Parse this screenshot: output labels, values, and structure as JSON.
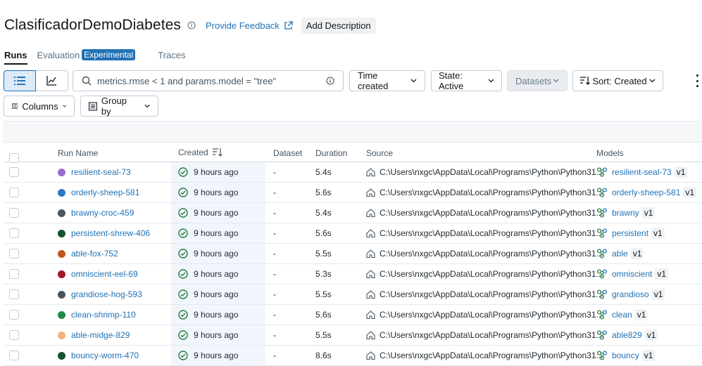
{
  "header": {
    "title": "ClasificadorDemoDiabetes",
    "feedback_label": "Provide Feedback",
    "add_description_label": "Add Description"
  },
  "tabs": {
    "runs": "Runs",
    "evaluation": "Evaluation",
    "experimental_badge": "Experimental",
    "traces": "Traces"
  },
  "toolbar": {
    "search_value": "metrics.rmse < 1 and params.model = \"tree\"",
    "time_created": "Time created",
    "state": "State: Active",
    "datasets": "Datasets",
    "sort": "Sort: Created",
    "columns": "Columns",
    "group_by": "Group by"
  },
  "table": {
    "headers": {
      "run_name": "Run Name",
      "created": "Created",
      "dataset": "Dataset",
      "duration": "Duration",
      "source": "Source",
      "models": "Models"
    },
    "rows": [
      {
        "name": "resilient-seal-73",
        "color": "#9b6bd1",
        "created": "9 hours ago",
        "dataset": "-",
        "duration": "5.4s",
        "source": "C:\\Users\\nxgc\\AppData\\Local\\Programs\\Python\\Python31...",
        "model": "resilient-seal-73",
        "version": "v1"
      },
      {
        "name": "orderly-sheep-581",
        "color": "#2b78c4",
        "created": "9 hours ago",
        "dataset": "-",
        "duration": "5.6s",
        "source": "C:\\Users\\nxgc\\AppData\\Local\\Programs\\Python\\Python31...",
        "model": "orderly-sheep-581",
        "version": "v1"
      },
      {
        "name": "brawny-croc-459",
        "color": "#4a5560",
        "created": "9 hours ago",
        "dataset": "-",
        "duration": "5.4s",
        "source": "C:\\Users\\nxgc\\AppData\\Local\\Programs\\Python\\Python31...",
        "model": "brawny",
        "version": "v1"
      },
      {
        "name": "persistent-shrew-406",
        "color": "#14532d",
        "created": "9 hours ago",
        "dataset": "-",
        "duration": "5.6s",
        "source": "C:\\Users\\nxgc\\AppData\\Local\\Programs\\Python\\Python31...",
        "model": "persistent",
        "version": "v1"
      },
      {
        "name": "able-fox-752",
        "color": "#c2551e",
        "created": "9 hours ago",
        "dataset": "-",
        "duration": "5.5s",
        "source": "C:\\Users\\nxgc\\AppData\\Local\\Programs\\Python\\Python31...",
        "model": "able",
        "version": "v1"
      },
      {
        "name": "omniscient-eel-69",
        "color": "#a3142b",
        "created": "9 hours ago",
        "dataset": "-",
        "duration": "5.3s",
        "source": "C:\\Users\\nxgc\\AppData\\Local\\Programs\\Python\\Python31...",
        "model": "omniscient",
        "version": "v1"
      },
      {
        "name": "grandiose-hog-593",
        "color": "#4a5560",
        "created": "9 hours ago",
        "dataset": "-",
        "duration": "5.5s",
        "source": "C:\\Users\\nxgc\\AppData\\Local\\Programs\\Python\\Python31...",
        "model": "grandioso",
        "version": "v1"
      },
      {
        "name": "clean-shrimp-110",
        "color": "#1e8a48",
        "created": "9 hours ago",
        "dataset": "-",
        "duration": "5.6s",
        "source": "C:\\Users\\nxgc\\AppData\\Local\\Programs\\Python\\Python31...",
        "model": "clean",
        "version": "v1"
      },
      {
        "name": "able-midge-829",
        "color": "#f0b47a",
        "created": "9 hours ago",
        "dataset": "-",
        "duration": "5.5s",
        "source": "C:\\Users\\nxgc\\AppData\\Local\\Programs\\Python\\Python31...",
        "model": "able829",
        "version": "v1"
      },
      {
        "name": "bouncy-worm-470",
        "color": "#14532d",
        "created": "9 hours ago",
        "dataset": "-",
        "duration": "8.6s",
        "source": "C:\\Users\\nxgc\\AppData\\Local\\Programs\\Python\\Python31...",
        "model": "bouncy",
        "version": "v1"
      }
    ]
  }
}
